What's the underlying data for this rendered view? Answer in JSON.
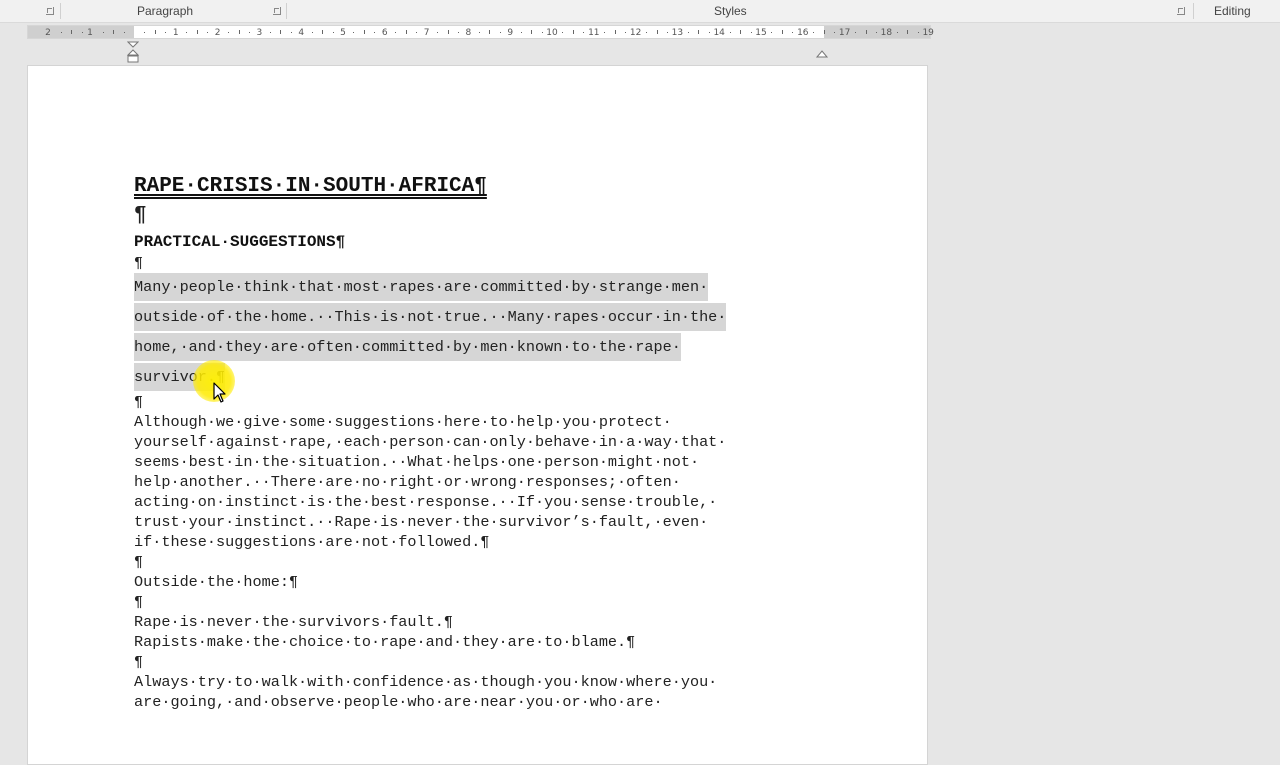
{
  "ribbon": {
    "paragraph_label": "Paragraph",
    "styles_label": "Styles",
    "editing_label": "Editing"
  },
  "ruler": {
    "left_numbers": [
      "2",
      "1"
    ],
    "numbers": [
      "1",
      "2",
      "3",
      "4",
      "5",
      "6",
      "7",
      "8",
      "9",
      "10",
      "11",
      "12",
      "13",
      "14",
      "15",
      "16",
      "17",
      "18",
      "19"
    ]
  },
  "document": {
    "title": "RAPE·CRISIS·IN·SOUTH·AFRICA¶",
    "blank_big": "¶",
    "heading": "PRACTICAL·SUGGESTIONS¶",
    "blank": "¶",
    "selected_lines": [
      "Many·people·think·that·most·rapes·are·committed·by·strange·men·",
      "outside·of·the·home.··This·is·not·true.··Many·rapes·occur·in·the·",
      "home,·and·they·are·often·committed·by·men·known·to·the·rape·",
      "survivor.¶"
    ],
    "para2_lines": [
      "Although·we·give·some·suggestions·here·to·help·you·protect·",
      "yourself·against·rape,·each·person·can·only·behave·in·a·way·that·",
      "seems·best·in·the·situation.··What·helps·one·person·might·not·",
      "help·another.··There·are·no·right·or·wrong·responses;·often·",
      "acting·on·instinct·is·the·best·response.··If·you·sense·trouble,·",
      "trust·your·instinct.··Rape·is·never·the·survivor’s·fault,·even·",
      "if·these·suggestions·are·not·followed.¶"
    ],
    "outside_heading": "Outside·the·home:¶",
    "never_fault": "Rape·is·never·the·survivors·fault.¶",
    "rapists_choice": "Rapists·make·the·choice·to·rape·and·they·are·to·blame.¶",
    "para3_lines": [
      "Always·try·to·walk·with·confidence·as·though·you·know·where·you·",
      "are·going,·and·observe·people·who·are·near·you·or·who·are·"
    ]
  }
}
